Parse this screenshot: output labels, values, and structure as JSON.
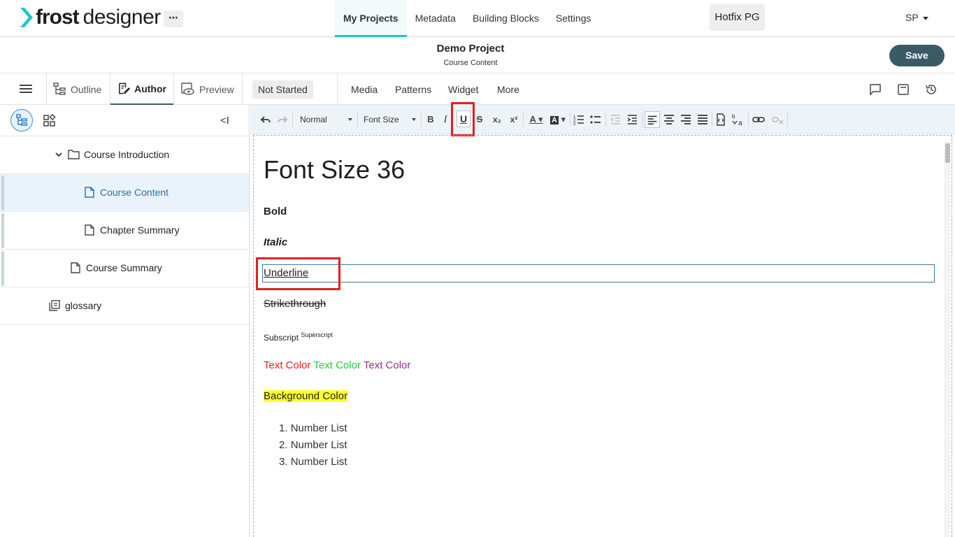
{
  "brand": {
    "frost": "frost",
    "designer": "designer",
    "accent": "#1ec8c8"
  },
  "topnav": {
    "more": "⋯",
    "items": [
      "My Projects",
      "Metadata",
      "Building Blocks",
      "Settings"
    ],
    "active": "My Projects",
    "workspace": "Hotfix PG",
    "user": "SP"
  },
  "project": {
    "title": "Demo Project",
    "subtitle": "Course Content",
    "save_label": "Save"
  },
  "tabs": {
    "outline": "Outline",
    "author": "Author",
    "preview": "Preview",
    "status": "Not Started"
  },
  "subnav": [
    "Media",
    "Patterns",
    "Widget",
    "More"
  ],
  "toolbar": {
    "style_select": "Normal",
    "font_size_select": "Font Size",
    "bold": "B",
    "italic": "I",
    "underline": "U",
    "strike": "S",
    "subscript": "x₂",
    "superscript": "x²",
    "text_color": "A",
    "bg_color": "A"
  },
  "tree": [
    {
      "label": "Course Introduction"
    },
    {
      "label": "Course Content"
    },
    {
      "label": "Chapter Summary"
    },
    {
      "label": "Course Summary"
    },
    {
      "label": "glossary"
    }
  ],
  "doc": {
    "heading": "Font Size 36",
    "bold": "Bold",
    "italic": "Italic",
    "underline": "Underline",
    "strike": "Strikethrough",
    "subscript": "Subscript",
    "superscript": "Superscript",
    "color_red": "Text Color",
    "color_green": "Text Color",
    "color_purple": "Text Color",
    "bg": "Background Color",
    "list": [
      "Number List",
      "Number List",
      "Number List"
    ]
  },
  "colors": {
    "red": "#e02020",
    "green": "#22cc44",
    "purple": "#9b2a8a",
    "highlight": "#ffff33",
    "save_bg": "#3b5a66"
  }
}
